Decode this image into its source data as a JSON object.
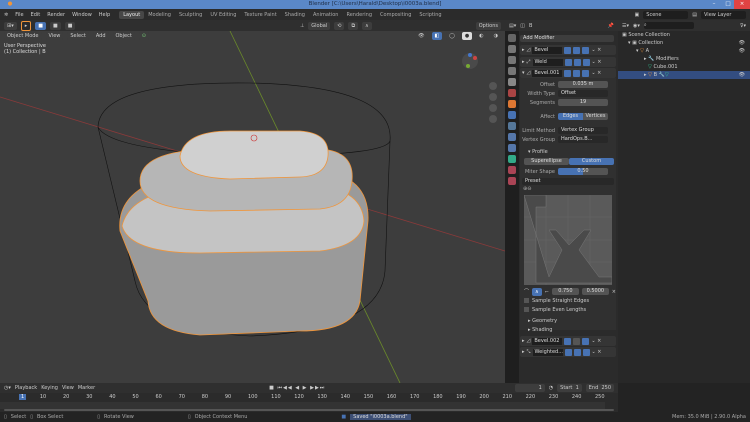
{
  "window": {
    "title": "Blender [C:\\Users\\Harald\\Desktop\\i0003a.blend]",
    "minimize": "–",
    "maximize": "□",
    "close": "×"
  },
  "menu": [
    "File",
    "Edit",
    "Render",
    "Window",
    "Help"
  ],
  "workspaces": [
    "Layout",
    "Modeling",
    "Sculpting",
    "UV Editing",
    "Texture Paint",
    "Shading",
    "Animation",
    "Rendering",
    "Compositing",
    "Scripting"
  ],
  "scene": {
    "scene_name": "Scene",
    "view_layer": "View Layer"
  },
  "viewport": {
    "mode": "Object Mode",
    "menus": [
      "View",
      "Select",
      "Add",
      "Object"
    ],
    "orientation": "Global",
    "options": "Options",
    "info_line1": "User Perspective",
    "info_line2": "(1) Collection | B"
  },
  "properties": {
    "object_name": "B",
    "add_modifier": "Add Modifier",
    "modifiers": [
      "Bevel",
      "Weld",
      "Bevel.001",
      "Bevel.002",
      "Weighted..."
    ],
    "fields": {
      "offset_label": "Offset",
      "offset": "0.035 m",
      "width_type_label": "Width Type",
      "width_type": "Offset",
      "segments_label": "Segments",
      "segments": "19",
      "affect_label": "Affect",
      "affect_edges": "Edges",
      "affect_vertices": "Vertices",
      "limit_method_label": "Limit Method",
      "limit_method": "Vertex Group",
      "vertex_group_label": "Vertex Group",
      "vertex_group": "HardOps.B...",
      "profile_label": "Profile",
      "superellipse": "Superellipse",
      "custom": "Custom",
      "miter_shape_label": "Miter Shape",
      "miter_shape": "0.50",
      "preset": "Preset",
      "curve_x": "0.750",
      "curve_y": "0.5000",
      "sample_straight": "Sample Straight Edges",
      "sample_even": "Sample Even Lengths",
      "geometry": "Geometry",
      "shading": "Shading"
    }
  },
  "outliner": {
    "items": [
      "Scene Collection",
      "Collection",
      "A",
      "Modifiers",
      "Cube.001",
      "B"
    ]
  },
  "timeline": {
    "menus": [
      "Playback",
      "Keying",
      "View",
      "Marker"
    ],
    "current_frame": "1",
    "start_label": "Start",
    "start": "1",
    "end_label": "End",
    "end": "250",
    "ticks": [
      "1",
      "10",
      "20",
      "30",
      "40",
      "50",
      "60",
      "70",
      "80",
      "90",
      "100",
      "110",
      "120",
      "130",
      "140",
      "150",
      "160",
      "170",
      "180",
      "190",
      "200",
      "210",
      "220",
      "230",
      "240",
      "250"
    ]
  },
  "status": {
    "select": "Select",
    "box_select": "Box Select",
    "rotate": "Rotate View",
    "context": "Object Context Menu",
    "saved": "Saved \"i0003a.blend\"",
    "mem": "Mem: 35.0 MiB | 2.90.0 Alpha"
  },
  "colors": {
    "accent": "#4772b3",
    "selection_outline": "#f0953a",
    "title_bar": "#5a88c8"
  }
}
